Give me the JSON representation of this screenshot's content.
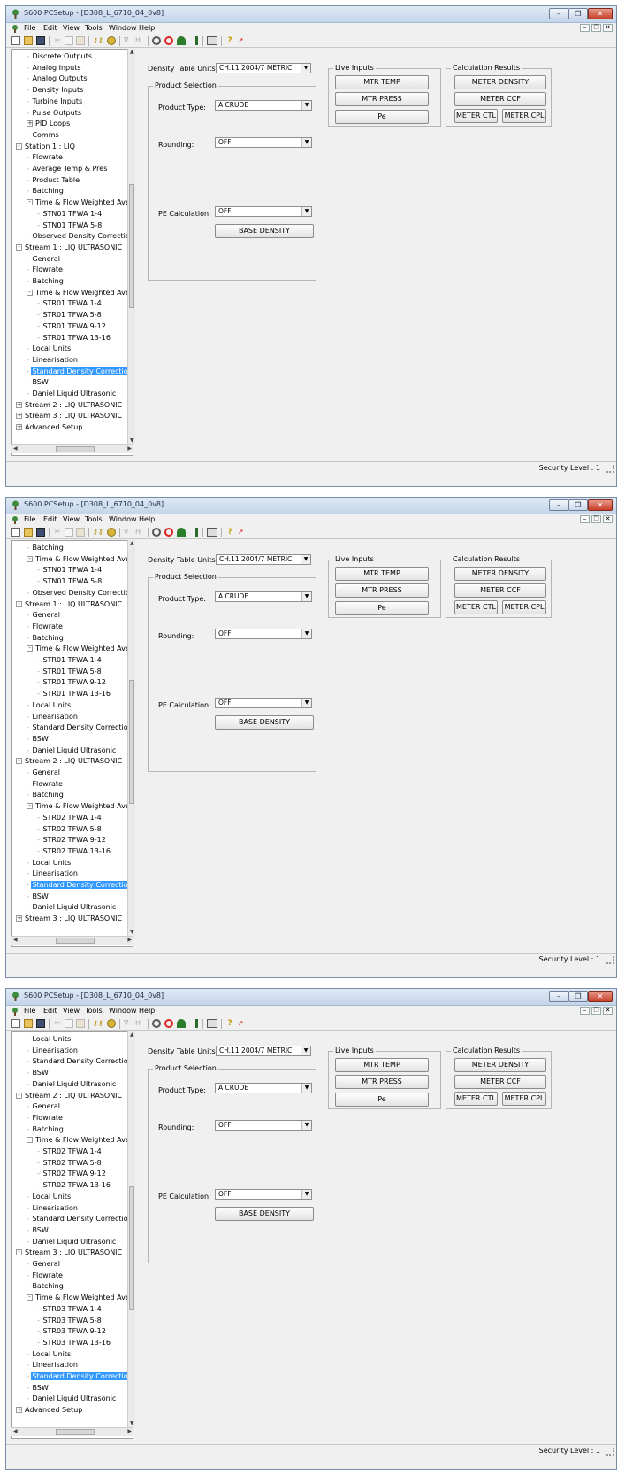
{
  "app": {
    "title": "S600 PCSetup - [D308_L_6710_04_0v8]",
    "menu": [
      "File",
      "Edit",
      "View",
      "Tools",
      "Window",
      "Help"
    ],
    "status": "Security Level : 1"
  },
  "tree_scroll_tops": [
    0.5,
    0.52,
    0.58
  ],
  "main": {
    "density_table_label": "Density Table Units",
    "density_table_value": "CH.11 2004/7 METRIC",
    "product_selection_title": "Product Selection",
    "product_type_label": "Product Type:",
    "product_type_value": "A CRUDE",
    "rounding_label": "Rounding:",
    "rounding_value": "OFF",
    "pe_calc_label": "PE Calculation:",
    "pe_calc_value": "OFF",
    "base_density_button": "BASE DENSITY",
    "live_inputs_title": "Live Inputs",
    "live_inputs": [
      "MTR TEMP",
      "MTR PRESS",
      "Pe"
    ],
    "calc_results_title": "Calculation Results",
    "meter_density_button": "METER DENSITY",
    "meter_ccf_button": "METER CCF",
    "meter_ctl_button": "METER CTL",
    "meter_cpl_button": "METER CPL"
  },
  "windows": [
    {
      "tree": [
        {
          "label": "Discrete Outputs",
          "depth": 1
        },
        {
          "label": "Analog Inputs",
          "depth": 1
        },
        {
          "label": "Analog Outputs",
          "depth": 1
        },
        {
          "label": "Density Inputs",
          "depth": 1
        },
        {
          "label": "Turbine Inputs",
          "depth": 1
        },
        {
          "label": "Pulse Outputs",
          "depth": 1
        },
        {
          "label": "PID Loops",
          "depth": 1,
          "toggle": "+"
        },
        {
          "label": "Comms",
          "depth": 1
        },
        {
          "label": "Station 1 : LIQ",
          "depth": 0,
          "toggle": "-"
        },
        {
          "label": "Flowrate",
          "depth": 1
        },
        {
          "label": "Average Temp & Pres",
          "depth": 1
        },
        {
          "label": "Product Table",
          "depth": 1
        },
        {
          "label": "Batching",
          "depth": 1
        },
        {
          "label": "Time & Flow Weighted Ave",
          "depth": 1,
          "toggle": "-"
        },
        {
          "label": "STN01 TFWA 1-4",
          "depth": 2
        },
        {
          "label": "STN01 TFWA 5-8",
          "depth": 2
        },
        {
          "label": "Observed Density Correctio",
          "depth": 1
        },
        {
          "label": "Stream 1 : LIQ ULTRASONIC",
          "depth": 0,
          "toggle": "-"
        },
        {
          "label": "General",
          "depth": 1
        },
        {
          "label": "Flowrate",
          "depth": 1
        },
        {
          "label": "Batching",
          "depth": 1
        },
        {
          "label": "Time & Flow Weighted Ave",
          "depth": 1,
          "toggle": "-"
        },
        {
          "label": "STR01 TFWA 1-4",
          "depth": 2
        },
        {
          "label": "STR01 TFWA 5-8",
          "depth": 2
        },
        {
          "label": "STR01 TFWA 9-12",
          "depth": 2
        },
        {
          "label": "STR01 TFWA 13-16",
          "depth": 2
        },
        {
          "label": "Local Units",
          "depth": 1
        },
        {
          "label": "Linearisation",
          "depth": 1
        },
        {
          "label": "Standard Density Correction",
          "depth": 1,
          "selected": true
        },
        {
          "label": "BSW",
          "depth": 1
        },
        {
          "label": "Daniel Liquid Ultrasonic",
          "depth": 1
        },
        {
          "label": "Stream 2 : LIQ ULTRASONIC",
          "depth": 0,
          "toggle": "+"
        },
        {
          "label": "Stream 3 : LIQ ULTRASONIC",
          "depth": 0,
          "toggle": "+"
        },
        {
          "label": "Advanced Setup",
          "depth": 0,
          "toggle": "+"
        }
      ]
    },
    {
      "tree": [
        {
          "label": "Batching",
          "depth": 1
        },
        {
          "label": "Time & Flow Weighted Ave",
          "depth": 1,
          "toggle": "-"
        },
        {
          "label": "STN01 TFWA 1-4",
          "depth": 2
        },
        {
          "label": "STN01 TFWA 5-8",
          "depth": 2
        },
        {
          "label": "Observed Density Correctio",
          "depth": 1
        },
        {
          "label": "Stream 1 : LIQ ULTRASONIC",
          "depth": 0,
          "toggle": "-"
        },
        {
          "label": "General",
          "depth": 1
        },
        {
          "label": "Flowrate",
          "depth": 1
        },
        {
          "label": "Batching",
          "depth": 1
        },
        {
          "label": "Time & Flow Weighted Ave",
          "depth": 1,
          "toggle": "-"
        },
        {
          "label": "STR01 TFWA 1-4",
          "depth": 2
        },
        {
          "label": "STR01 TFWA 5-8",
          "depth": 2
        },
        {
          "label": "STR01 TFWA 9-12",
          "depth": 2
        },
        {
          "label": "STR01 TFWA 13-16",
          "depth": 2
        },
        {
          "label": "Local Units",
          "depth": 1
        },
        {
          "label": "Linearisation",
          "depth": 1
        },
        {
          "label": "Standard Density Correctio",
          "depth": 1
        },
        {
          "label": "BSW",
          "depth": 1
        },
        {
          "label": "Daniel Liquid Ultrasonic",
          "depth": 1
        },
        {
          "label": "Stream 2 : LIQ ULTRASONIC",
          "depth": 0,
          "toggle": "-"
        },
        {
          "label": "General",
          "depth": 1
        },
        {
          "label": "Flowrate",
          "depth": 1
        },
        {
          "label": "Batching",
          "depth": 1
        },
        {
          "label": "Time & Flow Weighted Ave",
          "depth": 1,
          "toggle": "-"
        },
        {
          "label": "STR02 TFWA 1-4",
          "depth": 2
        },
        {
          "label": "STR02 TFWA 5-8",
          "depth": 2
        },
        {
          "label": "STR02 TFWA 9-12",
          "depth": 2
        },
        {
          "label": "STR02 TFWA 13-16",
          "depth": 2
        },
        {
          "label": "Local Units",
          "depth": 1
        },
        {
          "label": "Linearisation",
          "depth": 1
        },
        {
          "label": "Standard Density Correction",
          "depth": 1,
          "selected": true
        },
        {
          "label": "BSW",
          "depth": 1
        },
        {
          "label": "Daniel Liquid Ultrasonic",
          "depth": 1
        },
        {
          "label": "Stream 3 : LIQ ULTRASONIC",
          "depth": 0,
          "toggle": "+"
        }
      ]
    },
    {
      "tree": [
        {
          "label": "Local Units",
          "depth": 1
        },
        {
          "label": "Linearisation",
          "depth": 1
        },
        {
          "label": "Standard Density Correctio",
          "depth": 1
        },
        {
          "label": "BSW",
          "depth": 1
        },
        {
          "label": "Daniel Liquid Ultrasonic",
          "depth": 1
        },
        {
          "label": "Stream 2 : LIQ ULTRASONIC",
          "depth": 0,
          "toggle": "-"
        },
        {
          "label": "General",
          "depth": 1
        },
        {
          "label": "Flowrate",
          "depth": 1
        },
        {
          "label": "Batching",
          "depth": 1
        },
        {
          "label": "Time & Flow Weighted Ave",
          "depth": 1,
          "toggle": "-"
        },
        {
          "label": "STR02 TFWA 1-4",
          "depth": 2
        },
        {
          "label": "STR02 TFWA 5-8",
          "depth": 2
        },
        {
          "label": "STR02 TFWA 9-12",
          "depth": 2
        },
        {
          "label": "STR02 TFWA 13-16",
          "depth": 2
        },
        {
          "label": "Local Units",
          "depth": 1
        },
        {
          "label": "Linearisation",
          "depth": 1
        },
        {
          "label": "Standard Density Correctio",
          "depth": 1
        },
        {
          "label": "BSW",
          "depth": 1
        },
        {
          "label": "Daniel Liquid Ultrasonic",
          "depth": 1
        },
        {
          "label": "Stream 3 : LIQ ULTRASONIC",
          "depth": 0,
          "toggle": "-"
        },
        {
          "label": "General",
          "depth": 1
        },
        {
          "label": "Flowrate",
          "depth": 1
        },
        {
          "label": "Batching",
          "depth": 1
        },
        {
          "label": "Time & Flow Weighted Ave",
          "depth": 1,
          "toggle": "-"
        },
        {
          "label": "STR03 TFWA 1-4",
          "depth": 2
        },
        {
          "label": "STR03 TFWA 5-8",
          "depth": 2
        },
        {
          "label": "STR03 TFWA 9-12",
          "depth": 2
        },
        {
          "label": "STR03 TFWA 13-16",
          "depth": 2
        },
        {
          "label": "Local Units",
          "depth": 1
        },
        {
          "label": "Linearisation",
          "depth": 1
        },
        {
          "label": "Standard Density Correction",
          "depth": 1,
          "selected": true
        },
        {
          "label": "BSW",
          "depth": 1
        },
        {
          "label": "Daniel Liquid Ultrasonic",
          "depth": 1
        },
        {
          "label": "Advanced Setup",
          "depth": 0,
          "toggle": "+"
        }
      ]
    }
  ]
}
